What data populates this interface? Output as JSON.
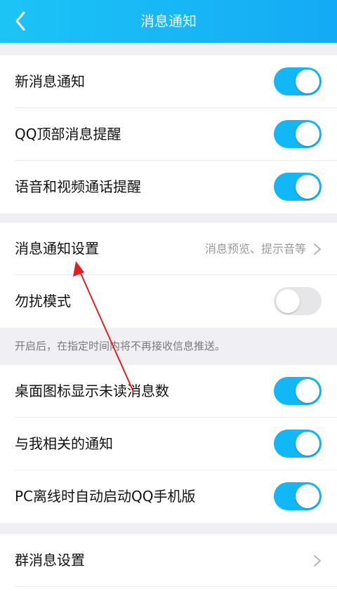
{
  "header": {
    "title": "消息通知"
  },
  "section1": [
    {
      "label": "新消息通知",
      "on": true
    },
    {
      "label": "QQ顶部消息提醒",
      "on": true
    },
    {
      "label": "语音和视频通话提醒",
      "on": true
    }
  ],
  "section2": {
    "notify_settings": {
      "label": "消息通知设置",
      "sub": "消息预览、提示音等"
    },
    "dnd": {
      "label": "勿扰模式",
      "on": false
    }
  },
  "hint": "开启后，在指定时间内将不再接收信息推送。",
  "section3": [
    {
      "label": "桌面图标显示未读消息数",
      "on": true
    },
    {
      "label": "与我相关的通知",
      "on": true
    },
    {
      "label": "PC离线时自动启动QQ手机版",
      "on": true
    }
  ],
  "section4": {
    "group": {
      "label": "群消息设置"
    }
  },
  "colors": {
    "accent": "#12b7f5",
    "annotation": "#e02020"
  }
}
